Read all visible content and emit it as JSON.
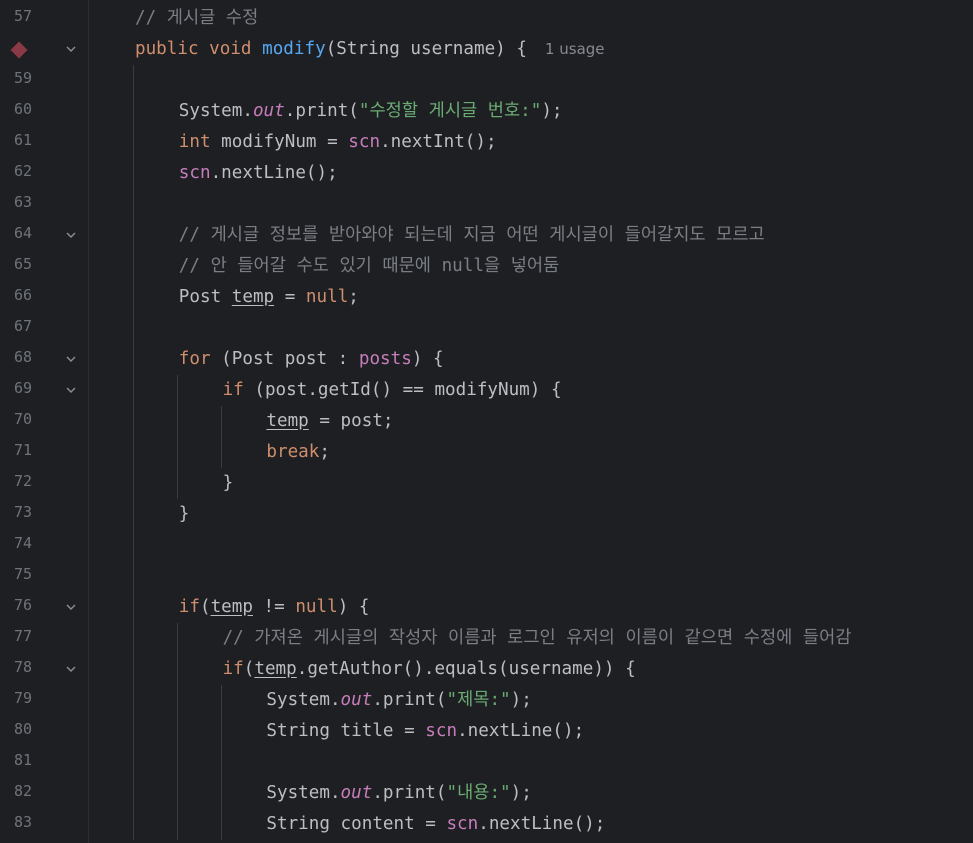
{
  "editor": {
    "language": "java",
    "inlay_hint": "1 usage",
    "colors": {
      "background": "#1e1f22",
      "keyword": "#cf8e6d",
      "string": "#6aab73",
      "comment": "#7a7e85",
      "method_declaration": "#56a8f5",
      "field": "#c77dbb",
      "text": "#bcbec4",
      "line_number": "#6f737a",
      "breakpoint": "#8a3a47"
    },
    "lines": [
      {
        "n": "57",
        "tokens": [
          {
            "t": "// 게시글 수정",
            "c": "cm"
          }
        ]
      },
      {
        "n": "58",
        "tokens": [
          {
            "t": "public",
            "c": "kw"
          },
          {
            "t": " "
          },
          {
            "t": "void",
            "c": "kw"
          },
          {
            "t": " "
          },
          {
            "t": "modify",
            "c": "fn"
          },
          {
            "t": "(String username) {"
          }
        ]
      },
      {
        "n": "59",
        "tokens": []
      },
      {
        "n": "60",
        "tokens": [
          {
            "t": "System."
          },
          {
            "t": "out",
            "c": "st"
          },
          {
            "t": ".print("
          },
          {
            "t": "\"수정할 게시글 번호:\"",
            "c": "str"
          },
          {
            "t": ");"
          }
        ]
      },
      {
        "n": "61",
        "tokens": [
          {
            "t": "int",
            "c": "kw"
          },
          {
            "t": " modifyNum = "
          },
          {
            "t": "scn",
            "c": "fld"
          },
          {
            "t": ".nextInt();"
          }
        ]
      },
      {
        "n": "62",
        "tokens": [
          {
            "t": "scn",
            "c": "fld"
          },
          {
            "t": ".nextLine();"
          }
        ]
      },
      {
        "n": "63",
        "tokens": []
      },
      {
        "n": "64",
        "tokens": [
          {
            "t": "// 게시글 정보를 받아와야 되는데 지금 어떤 게시글이 들어갈지도 모르고",
            "c": "cm"
          }
        ]
      },
      {
        "n": "65",
        "tokens": [
          {
            "t": "// 안 들어갈 수도 있기 때문에 null을 넣어둠",
            "c": "cm"
          }
        ]
      },
      {
        "n": "66",
        "tokens": [
          {
            "t": "Post "
          },
          {
            "t": "temp",
            "c": "ul"
          },
          {
            "t": " = "
          },
          {
            "t": "null",
            "c": "kw"
          },
          {
            "t": ";"
          }
        ]
      },
      {
        "n": "67",
        "tokens": []
      },
      {
        "n": "68",
        "tokens": [
          {
            "t": "for",
            "c": "kw"
          },
          {
            "t": " (Post post : "
          },
          {
            "t": "posts",
            "c": "fld"
          },
          {
            "t": ") {"
          }
        ]
      },
      {
        "n": "69",
        "tokens": [
          {
            "t": "if",
            "c": "kw"
          },
          {
            "t": " (post.getId() == modifyNum) {"
          }
        ]
      },
      {
        "n": "70",
        "tokens": [
          {
            "t": "temp",
            "c": "ul"
          },
          {
            "t": " = post;"
          }
        ]
      },
      {
        "n": "71",
        "tokens": [
          {
            "t": "break",
            "c": "kw"
          },
          {
            "t": ";"
          }
        ]
      },
      {
        "n": "72",
        "tokens": [
          {
            "t": "}"
          }
        ]
      },
      {
        "n": "73",
        "tokens": [
          {
            "t": "}"
          }
        ]
      },
      {
        "n": "74",
        "tokens": []
      },
      {
        "n": "75",
        "tokens": []
      },
      {
        "n": "76",
        "tokens": [
          {
            "t": "if",
            "c": "kw"
          },
          {
            "t": "("
          },
          {
            "t": "temp",
            "c": "ul"
          },
          {
            "t": " != "
          },
          {
            "t": "null",
            "c": "kw"
          },
          {
            "t": ") {"
          }
        ]
      },
      {
        "n": "77",
        "tokens": [
          {
            "t": "// 가져온 게시글의 작성자 이름과 로그인 유저의 이름이 같으면 수정에 들어감",
            "c": "cm"
          }
        ]
      },
      {
        "n": "78",
        "tokens": [
          {
            "t": "if",
            "c": "kw"
          },
          {
            "t": "("
          },
          {
            "t": "temp",
            "c": "ul"
          },
          {
            "t": ".getAuthor().equals(username)) {"
          }
        ]
      },
      {
        "n": "79",
        "tokens": [
          {
            "t": "System."
          },
          {
            "t": "out",
            "c": "st"
          },
          {
            "t": ".print("
          },
          {
            "t": "\"제목:\"",
            "c": "str"
          },
          {
            "t": ");"
          }
        ]
      },
      {
        "n": "80",
        "tokens": [
          {
            "t": "String title = "
          },
          {
            "t": "scn",
            "c": "fld"
          },
          {
            "t": ".nextLine();"
          }
        ]
      },
      {
        "n": "81",
        "tokens": []
      },
      {
        "n": "82",
        "tokens": [
          {
            "t": "System."
          },
          {
            "t": "out",
            "c": "st"
          },
          {
            "t": ".print("
          },
          {
            "t": "\"내용:\"",
            "c": "str"
          },
          {
            "t": ");"
          }
        ]
      },
      {
        "n": "83",
        "tokens": [
          {
            "t": "String content = "
          },
          {
            "t": "scn",
            "c": "fld"
          },
          {
            "t": ".nextLine();"
          }
        ]
      }
    ]
  }
}
